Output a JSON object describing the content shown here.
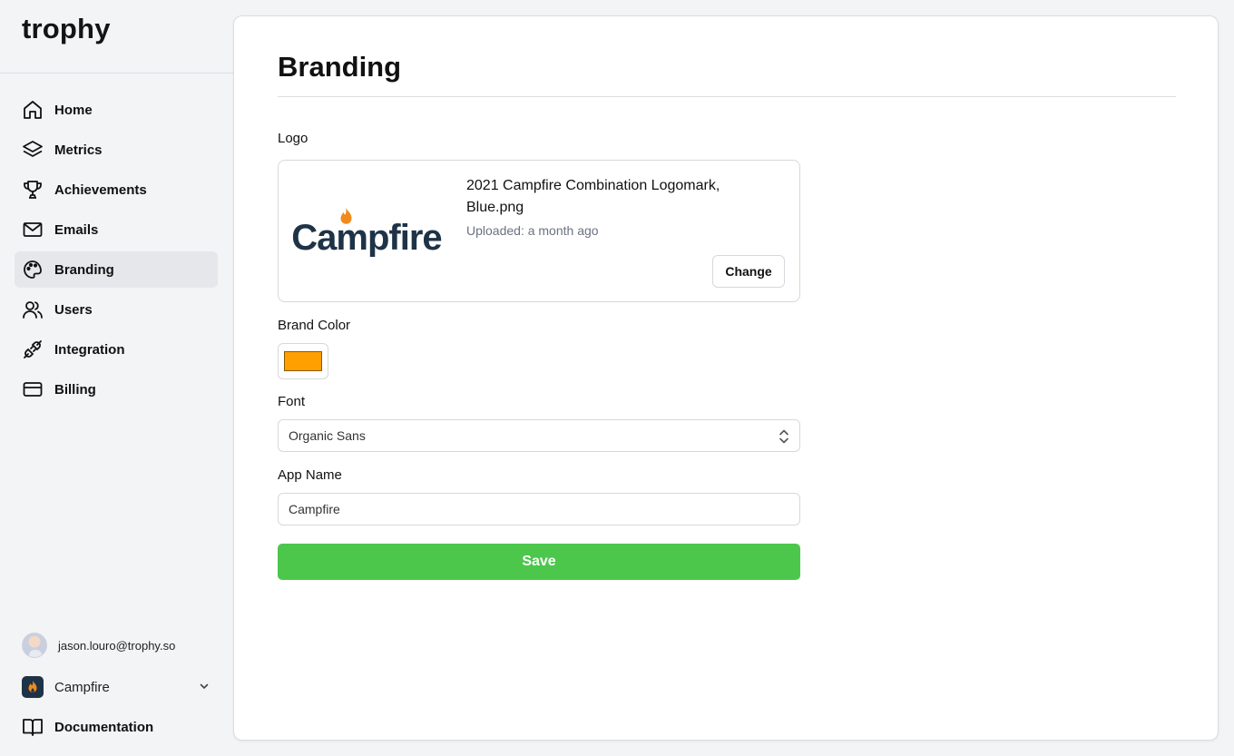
{
  "app": {
    "name": "trophy"
  },
  "sidebar": {
    "items": [
      {
        "label": "Home",
        "icon": "home-icon"
      },
      {
        "label": "Metrics",
        "icon": "layers-icon"
      },
      {
        "label": "Achievements",
        "icon": "trophy-icon"
      },
      {
        "label": "Emails",
        "icon": "mail-icon"
      },
      {
        "label": "Branding",
        "icon": "palette-icon",
        "active": true
      },
      {
        "label": "Users",
        "icon": "users-icon"
      },
      {
        "label": "Integration",
        "icon": "plug-icon"
      },
      {
        "label": "Billing",
        "icon": "credit-card-icon"
      }
    ],
    "user_email": "jason.louro@trophy.so",
    "organization": "Campfire",
    "documentation_label": "Documentation"
  },
  "main": {
    "title": "Branding",
    "logo": {
      "label": "Logo",
      "image_text": "Campfire",
      "file_name": "2021 Campfire Combination Logomark, Blue.png",
      "uploaded": "Uploaded: a month ago",
      "change_label": "Change"
    },
    "brand_color": {
      "label": "Brand Color",
      "value": "#ff9f00"
    },
    "font": {
      "label": "Font",
      "value": "Organic Sans"
    },
    "app_name": {
      "label": "App Name",
      "value": "Campfire"
    },
    "save_label": "Save"
  },
  "colors": {
    "accent_green": "#4cc74c",
    "logo_navy": "#1f3347",
    "logo_orange": "#f08a1c"
  }
}
